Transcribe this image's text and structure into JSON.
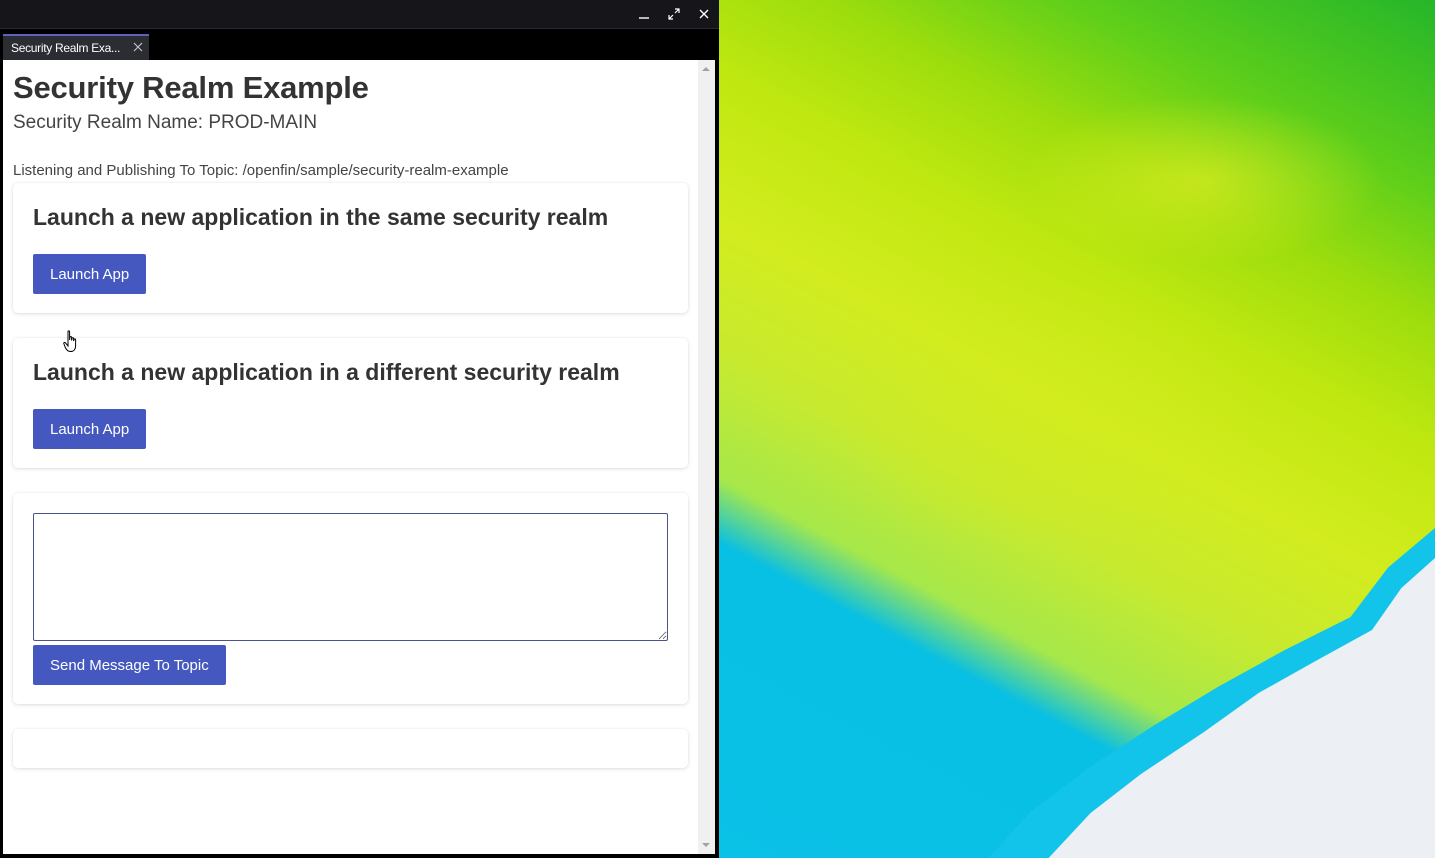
{
  "window": {
    "tab_title": "Security Realm Exa..."
  },
  "page": {
    "title": "Security Realm Example",
    "realm_name": "Security Realm Name: PROD-MAIN",
    "topic_line": "Listening and Publishing To Topic: /openfin/sample/security-realm-example"
  },
  "cards": {
    "same_realm": {
      "heading": "Launch a new application in the same security realm",
      "button": "Launch App"
    },
    "different_realm": {
      "heading": "Launch a new application in a different security realm",
      "button": "Launch App"
    },
    "message": {
      "textarea_value": "",
      "button": "Send Message To Topic"
    }
  },
  "icons": {
    "minimize": "minimize-icon",
    "maximize": "maximize-icon",
    "close": "close-icon",
    "tab_close": "close-icon",
    "cursor": "hand-pointer-icon"
  },
  "colors": {
    "accent": "#4558bf",
    "titlebar": "#16161a",
    "tab": "#2c2d33"
  }
}
